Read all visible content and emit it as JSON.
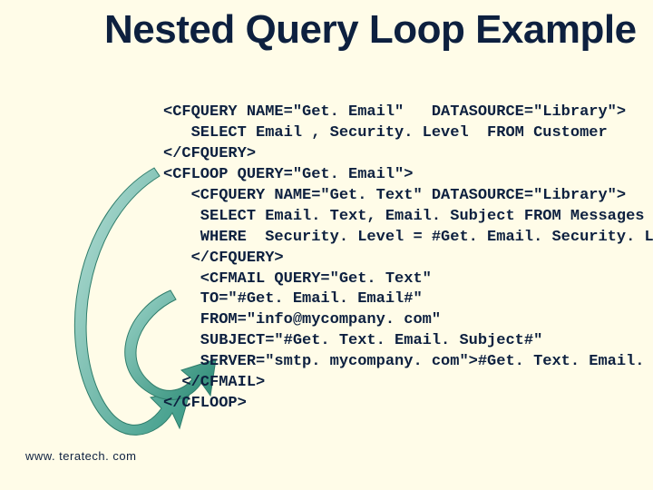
{
  "title": "Nested Query Loop\nExample",
  "code_lines": [
    "<CFQUERY NAME=\"Get. Email\"   DATASOURCE=\"Library\">",
    "   SELECT Email , Security. Level  FROM Customer",
    "</CFQUERY>",
    "<CFLOOP QUERY=\"Get. Email\">",
    "   <CFQUERY NAME=\"Get. Text\" DATASOURCE=\"Library\">",
    "    SELECT Email. Text, Email. Subject FROM Messages",
    "    WHERE  Security. Level = #Get. Email. Security. Level#",
    "   </CFQUERY>",
    "    <CFMAIL QUERY=\"Get. Text\"",
    "    TO=\"#Get. Email. Email#\"",
    "    FROM=\"info@mycompany. com\"",
    "    SUBJECT=\"#Get. Text. Email. Subject#\"",
    "    SERVER=\"smtp. mycompany. com\">#Get. Text. Email. Text#",
    "  </CFMAIL>",
    "</CFLOOP>"
  ],
  "footer": "www. teratech. com"
}
